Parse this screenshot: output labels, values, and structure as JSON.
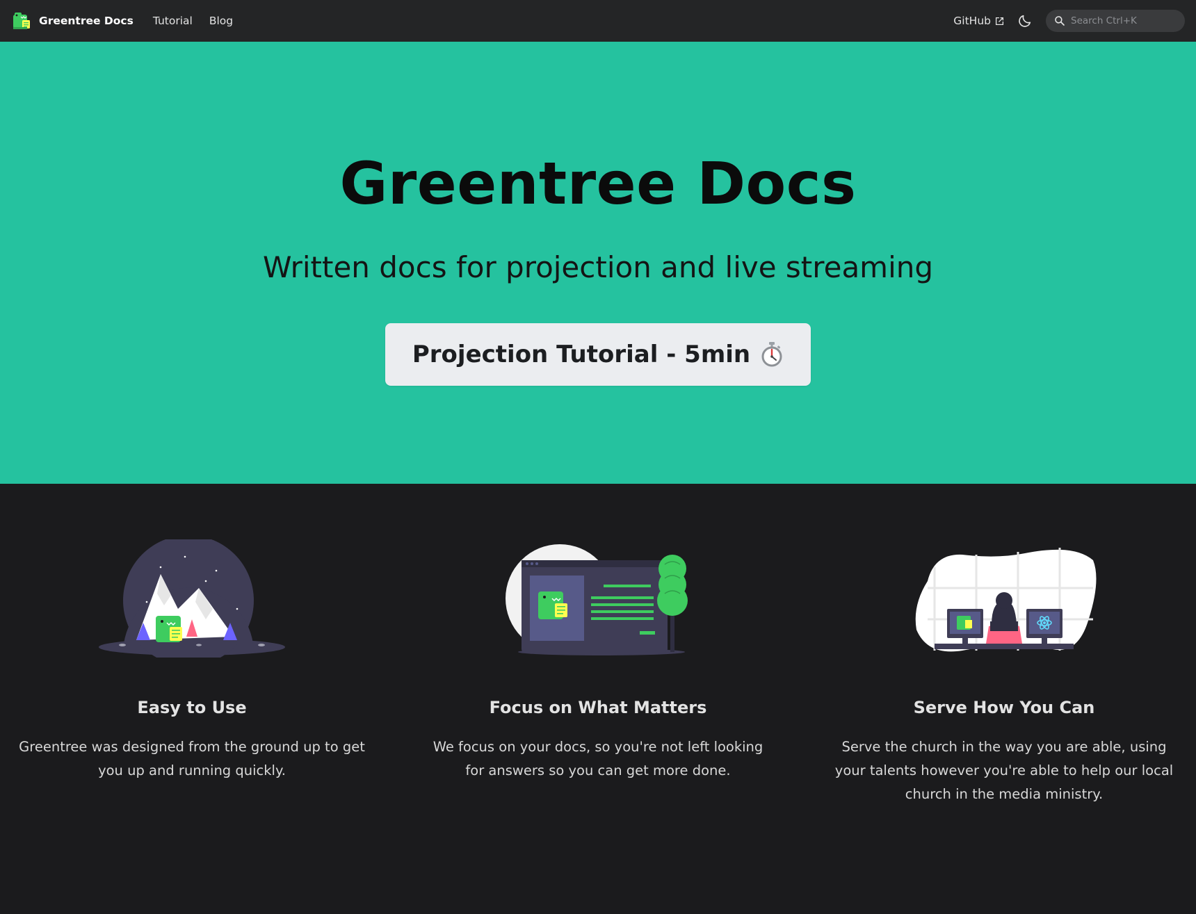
{
  "navbar": {
    "brand_title": "Greentree Docs",
    "links": [
      "Tutorial",
      "Blog"
    ],
    "github_label": "GitHub",
    "search_placeholder": "Search Ctrl+K"
  },
  "hero": {
    "title": "Greentree Docs",
    "subtitle": "Written docs for projection and live streaming",
    "button_label": "Projection Tutorial - 5min"
  },
  "features": [
    {
      "title": "Easy to Use",
      "description": "Greentree was designed from the ground up to get you up and running quickly."
    },
    {
      "title": "Focus on What Matters",
      "description": "We focus on your docs, so you're not left looking for answers so you can get more done."
    },
    {
      "title": "Serve How You Can",
      "description": "Serve the church in the way you are able, using your talents however you're able to help our local church in the media ministry."
    }
  ],
  "colors": {
    "navbar_bg": "#242526",
    "hero_bg": "#25c29f",
    "page_bg": "#1b1b1d",
    "button_bg": "#ebedf0",
    "accent_green": "#3ecc5f"
  },
  "icons": {
    "brand": "dinosaur-logo-icon",
    "external_link": "external-link-icon",
    "theme": "moon-icon",
    "search": "search-icon",
    "button": "stopwatch-icon"
  }
}
